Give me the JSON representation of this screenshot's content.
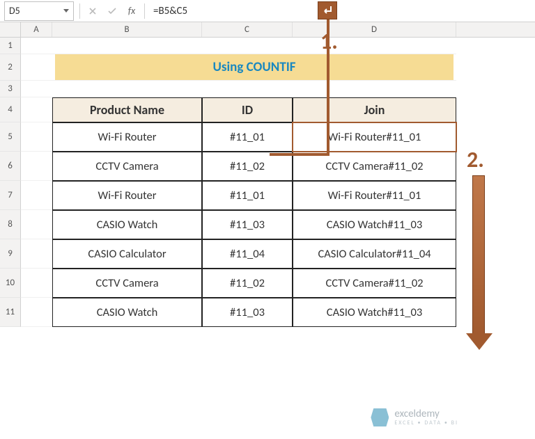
{
  "name_box": "D5",
  "formula": "=B5&C5",
  "columns": [
    "A",
    "B",
    "C",
    "D"
  ],
  "row_numbers": [
    "1",
    "2",
    "3",
    "4",
    "5",
    "6",
    "7",
    "8",
    "9",
    "10",
    "11"
  ],
  "banner_title": "Using COUNTIF",
  "headers": {
    "b": "Product Name",
    "c": "ID",
    "d": "Join"
  },
  "rows": [
    {
      "b": "Wi-Fi Router",
      "c": "#11_01",
      "d": "Wi-Fi Router#11_01"
    },
    {
      "b": "CCTV Camera",
      "c": "#11_02",
      "d": "CCTV Camera#11_02"
    },
    {
      "b": "Wi-Fi Router",
      "c": "#11_01",
      "d": "Wi-Fi Router#11_01"
    },
    {
      "b": "CASIO Watch",
      "c": "#11_03",
      "d": "CASIO Watch#11_03"
    },
    {
      "b": "CASIO Calculator",
      "c": "#11_04",
      "d": "CASIO Calculator#11_04"
    },
    {
      "b": "CCTV Camera",
      "c": "#11_02",
      "d": "CCTV Camera#11_02"
    },
    {
      "b": "CASIO Watch",
      "c": "#11_03",
      "d": "CASIO Watch#11_03"
    }
  ],
  "annotations": {
    "step1": "1.",
    "step2": "2."
  },
  "watermark": {
    "name": "exceldemy",
    "tagline": "EXCEL • DATA • BI"
  }
}
